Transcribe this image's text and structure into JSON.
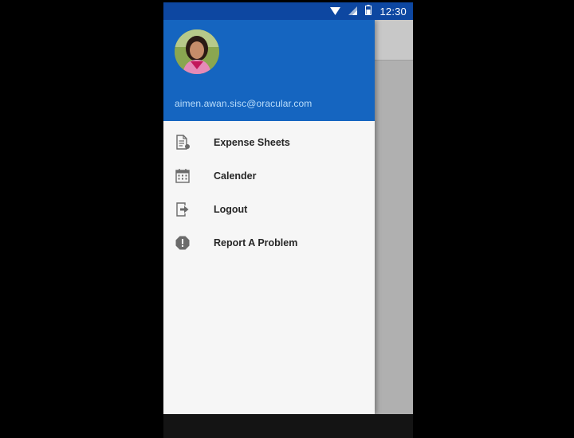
{
  "status_bar": {
    "time": "12:30",
    "icons": [
      "wifi-icon",
      "signal-icon",
      "battery-icon"
    ]
  },
  "drawer": {
    "header": {
      "email": "aimen.awan.sisc@oracular.com",
      "avatar": "profile-photo"
    },
    "items": [
      {
        "label": "Expense Sheets",
        "icon": "document-icon"
      },
      {
        "label": "Calender",
        "icon": "calendar-icon"
      },
      {
        "label": "Logout",
        "icon": "logout-icon"
      },
      {
        "label": "Report A Problem",
        "icon": "alert-icon"
      }
    ]
  },
  "colors": {
    "status_bar": "#0d47a1",
    "header": "#1565c0",
    "drawer_bg": "#f6f6f6",
    "email_text": "#bbdefb",
    "icon_gray": "#6b6b6b"
  }
}
